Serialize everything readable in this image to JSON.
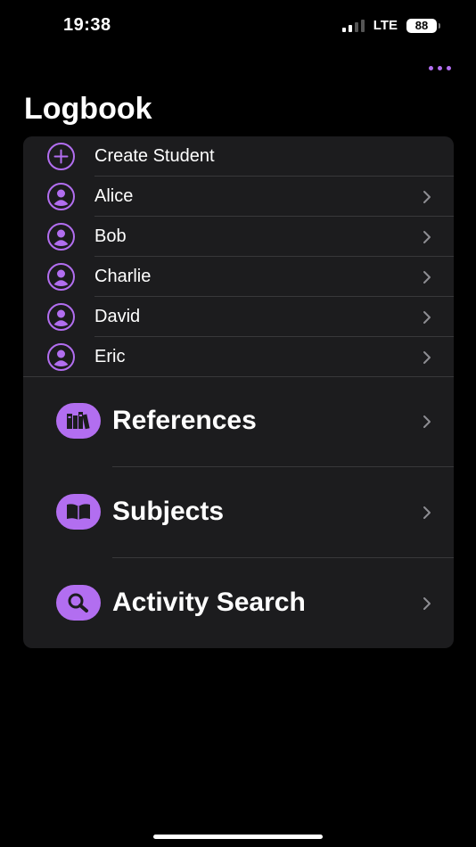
{
  "status_bar": {
    "time": "19:38",
    "network": "LTE",
    "battery": "88"
  },
  "header": {
    "title": "Logbook",
    "more_icon": "ellipsis-icon"
  },
  "students_list": {
    "create_label": "Create Student",
    "items": [
      {
        "name": "Alice"
      },
      {
        "name": "Bob"
      },
      {
        "name": "Charlie"
      },
      {
        "name": "David"
      },
      {
        "name": "Eric"
      }
    ]
  },
  "sections": [
    {
      "label": "References",
      "icon": "books-icon"
    },
    {
      "label": "Subjects",
      "icon": "open-book-icon"
    },
    {
      "label": "Activity Search",
      "icon": "magnifier-icon"
    }
  ],
  "colors": {
    "accent": "#b26ef0",
    "card": "#1c1c1e",
    "background": "#000000"
  }
}
